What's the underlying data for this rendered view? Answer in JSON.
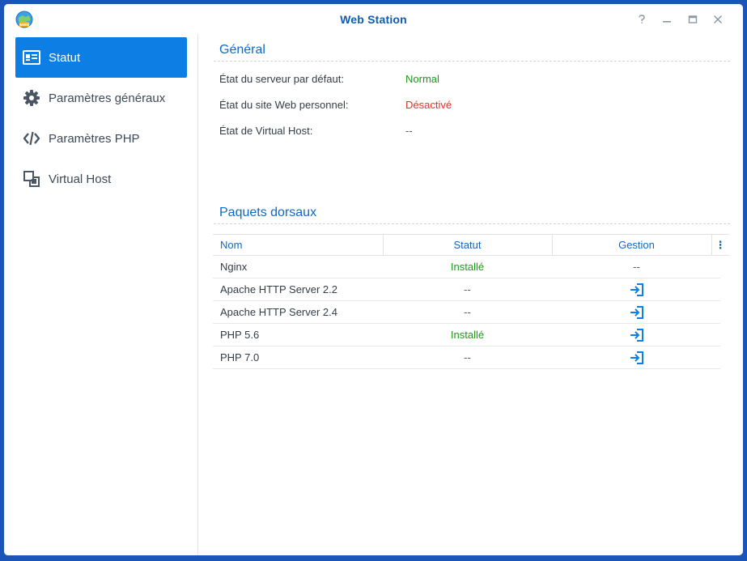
{
  "window": {
    "title": "Web Station",
    "buttons": {
      "help": "?",
      "minimize": "–",
      "maximize": "□",
      "close": "✕"
    }
  },
  "sidebar": {
    "items": [
      {
        "label": "Statut",
        "icon": "status-card-icon",
        "active": true
      },
      {
        "label": "Paramètres généraux",
        "icon": "gear-icon",
        "active": false
      },
      {
        "label": "Paramètres PHP",
        "icon": "code-icon",
        "active": false
      },
      {
        "label": "Virtual Host",
        "icon": "virtual-host-icon",
        "active": false
      }
    ]
  },
  "general": {
    "title": "Général",
    "rows": [
      {
        "label": "État du serveur par défaut:",
        "value": "Normal",
        "status": "ok"
      },
      {
        "label": "État du site Web personnel:",
        "value": "Désactivé",
        "status": "error"
      },
      {
        "label": "État de Virtual Host:",
        "value": "--",
        "status": "none"
      }
    ]
  },
  "packages": {
    "title": "Paquets dorsaux",
    "columns": {
      "name": "Nom",
      "status": "Statut",
      "manage": "Gestion",
      "menu": "⋮"
    },
    "rows": [
      {
        "name": "Nginx",
        "status": "Installé",
        "status_kind": "ok",
        "manage": "--",
        "manage_icon": false
      },
      {
        "name": "Apache HTTP Server 2.2",
        "status": "--",
        "status_kind": "none",
        "manage": "",
        "manage_icon": true
      },
      {
        "name": "Apache HTTP Server 2.4",
        "status": "--",
        "status_kind": "none",
        "manage": "",
        "manage_icon": true
      },
      {
        "name": "PHP 5.6",
        "status": "Installé",
        "status_kind": "ok",
        "manage": "",
        "manage_icon": true
      },
      {
        "name": "PHP 7.0",
        "status": "--",
        "status_kind": "none",
        "manage": "",
        "manage_icon": true
      }
    ]
  },
  "colors": {
    "accent": "#0d7ee3",
    "title_blue": "#0e5bb4",
    "ok_green": "#1c9a1c",
    "error_red": "#e8312b",
    "desktop_blue": "#1c55b8"
  }
}
